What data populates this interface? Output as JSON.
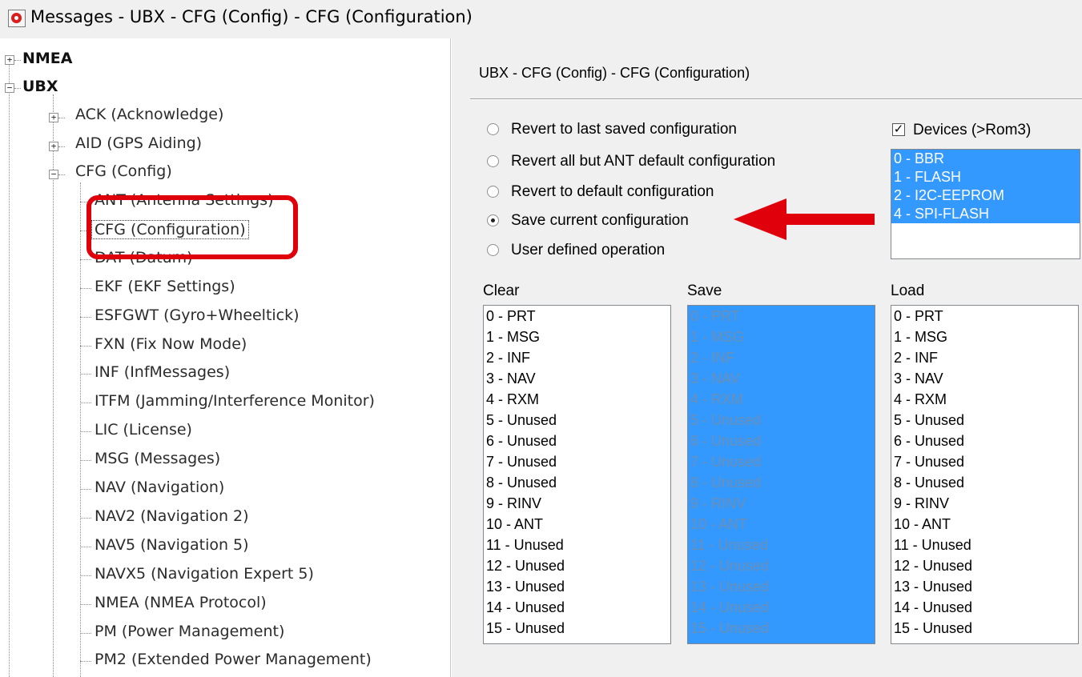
{
  "window": {
    "title": "Messages - UBX - CFG (Config) - CFG (Configuration)"
  },
  "tree": {
    "nmea": "NMEA",
    "ubx": "UBX",
    "groups": {
      "ack": "ACK (Acknowledge)",
      "aid": "AID (GPS Aiding)",
      "cfg": "CFG (Config)"
    },
    "cfg_children": [
      "ANT (Antenna Settings)",
      "CFG (Configuration)",
      "DAT (Datum)",
      "EKF (EKF Settings)",
      "ESFGWT (Gyro+Wheeltick)",
      "FXN (Fix Now Mode)",
      "INF (InfMessages)",
      "ITFM (Jamming/Interference Monitor)",
      "LIC (License)",
      "MSG (Messages)",
      "NAV (Navigation)",
      "NAV2 (Navigation 2)",
      "NAV5 (Navigation 5)",
      "NAVX5 (Navigation Expert 5)",
      "NMEA (NMEA Protocol)",
      "PM (Power Management)",
      "PM2 (Extended Power Management)"
    ],
    "selected": "CFG (Configuration)"
  },
  "panel": {
    "title": "UBX - CFG (Config) - CFG (Configuration)",
    "radio_options": [
      "Revert to last saved configuration",
      "Revert all but ANT default configuration",
      "Revert to default configuration",
      "Save current configuration",
      "User defined operation"
    ],
    "selected_radio": "Save current configuration",
    "devices_label": "Devices (>Rom3)",
    "devices_checked": true,
    "devices": [
      "0 - BBR",
      "1 - FLASH",
      "2 - I2C-EEPROM",
      "4 - SPI-FLASH"
    ],
    "clear_label": "Clear",
    "save_label": "Save",
    "load_label": "Load",
    "masks": [
      "0 - PRT",
      "1 - MSG",
      "2 - INF",
      "3 - NAV",
      "4 - RXM",
      "5 - Unused",
      "6 - Unused",
      "7 - Unused",
      "8 - Unused",
      "9 - RINV",
      "10 - ANT",
      "11 - Unused",
      "12 - Unused",
      "13 - Unused",
      "14 - Unused",
      "15 - Unused"
    ]
  },
  "colors": {
    "selection": "#3399ff",
    "annotation": "#e0000c"
  }
}
